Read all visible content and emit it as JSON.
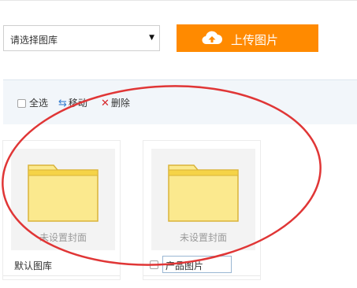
{
  "library_select": {
    "selected": "请选择图库",
    "caret": "▼"
  },
  "upload": {
    "label": "上传图片",
    "icon": "cloud-upload-icon",
    "color": "#ff8a00"
  },
  "toolbar": {
    "select_all": "全选",
    "move": "移动",
    "delete": "删除",
    "move_icon": "arrow-icon",
    "delete_icon": "close-icon"
  },
  "albums": [
    {
      "cover_text": "未设置封面",
      "name": "默认图库",
      "editing": false
    },
    {
      "cover_text": "未设置封面",
      "name": "产品图片",
      "editing": true
    }
  ],
  "colors": {
    "accent": "#ff8a00",
    "folder": "#fbe98e",
    "folder_edge": "#d9b33a",
    "annotation": "#e03636"
  }
}
